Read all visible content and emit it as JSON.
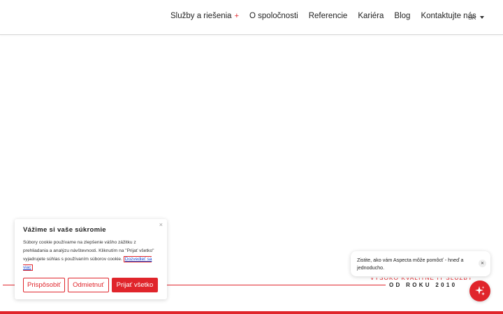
{
  "nav": {
    "items": [
      {
        "label": "Služby a riešenia",
        "has_plus": true
      },
      {
        "label": "O spoločnosti"
      },
      {
        "label": "Referencie"
      },
      {
        "label": "Kariéra"
      },
      {
        "label": "Blog"
      },
      {
        "label": "Kontaktujte nás"
      }
    ],
    "plus_symbol": "+",
    "language": "SK"
  },
  "tagline": {
    "line1": "VYSOKO  KVALITNÉ  IT  SLUŽBY",
    "line2": "OD ROKU 2010"
  },
  "cookie": {
    "title": "Vážime si vaše súkromie",
    "text": "Súbory cookie používame na zlepšenie vášho zážitku z prehliadania a analýzu návštevnosti. Kliknutím na \"Prijať všetko\" vyjadrujete súhlas s používaním súborov cookie.",
    "link": "Dozvedieť sa viac",
    "close": "×",
    "buttons": {
      "customize": "Prispôsobiť",
      "reject": "Odmietnuť",
      "accept": "Prijať všetko"
    }
  },
  "chat": {
    "message": "Zistite, ako vám Aspecta môže pomôcť - hneď a jednoducho.",
    "close": "✕",
    "icon": "sparkle-icon"
  },
  "colors": {
    "accent": "#e0252b",
    "link": "#1a4fd6"
  }
}
